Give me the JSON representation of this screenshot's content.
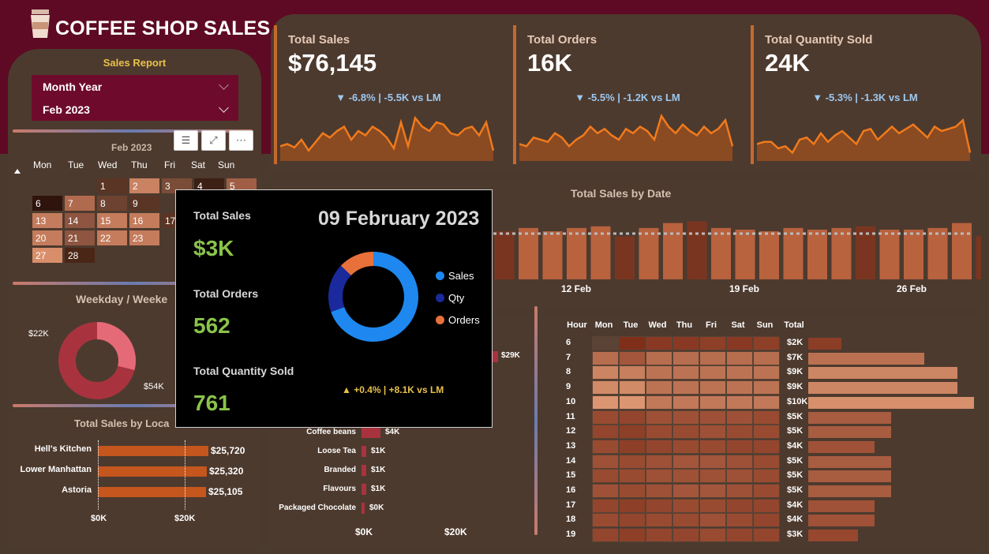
{
  "app": {
    "title": "COFFEE SHOP SALES"
  },
  "colors": {
    "accent": "#c46a2e",
    "brand": "#5e0a24",
    "delta_down": "#9cc8f0",
    "delta_up": "#e8c14a",
    "value_green": "#8bc34a"
  },
  "left": {
    "report_title": "Sales Report",
    "slicer_label": "Month Year",
    "slicer_value": "Feb 2023",
    "calendar": {
      "month_label": "Feb 2023",
      "days_header": [
        "Mon",
        "Tue",
        "Wed",
        "Thu",
        "Fri",
        "Sat",
        "Sun"
      ],
      "weeks": [
        [
          "",
          "",
          "1",
          "2",
          "3",
          "4",
          "5"
        ],
        [
          "6",
          "7",
          "8",
          "9",
          "",
          "",
          ""
        ],
        [
          "13",
          "14",
          "15",
          "16",
          "17",
          "",
          ""
        ],
        [
          "20",
          "21",
          "22",
          "23",
          "",
          "",
          ""
        ],
        [
          "27",
          "28",
          "",
          "",
          "",
          "",
          ""
        ]
      ]
    },
    "weekday_title": "Weekday / Weeke",
    "donut": {
      "label_a": "$22K",
      "label_b": "$54K"
    },
    "location_title": "Total Sales by Loca",
    "locations": [
      {
        "name": "Hell's Kitchen",
        "value": "$25,720",
        "amount": 25720
      },
      {
        "name": "Lower Manhattan",
        "value": "$25,320",
        "amount": 25320
      },
      {
        "name": "Astoria",
        "value": "$25,105",
        "amount": 25105
      }
    ],
    "location_axis": [
      "$0K",
      "$20K"
    ]
  },
  "kpis": [
    {
      "title": "Total Sales",
      "value": "$76,145",
      "delta": "▼ -6.8% | -5.5K vs LM"
    },
    {
      "title": "Total Orders",
      "value": "16K",
      "delta": "▼ -5.5% | -1.2K vs LM"
    },
    {
      "title": "Total Quantity Sold",
      "value": "24K",
      "delta": "▼ -5.3% | -1.3K vs LM"
    }
  ],
  "sparklines": [
    [
      0.25,
      0.3,
      0.22,
      0.4,
      0.15,
      0.35,
      0.55,
      0.45,
      0.6,
      0.7,
      0.4,
      0.6,
      0.5,
      0.7,
      0.6,
      0.45,
      0.2,
      0.8,
      0.25,
      0.9,
      0.7,
      0.6,
      0.8,
      0.75,
      0.55,
      0.5,
      0.65,
      0.7,
      0.5,
      0.8,
      0.15
    ],
    [
      0.3,
      0.25,
      0.45,
      0.4,
      0.35,
      0.55,
      0.45,
      0.25,
      0.4,
      0.5,
      0.7,
      0.55,
      0.65,
      0.5,
      0.4,
      0.65,
      0.55,
      0.7,
      0.6,
      0.4,
      0.95,
      0.7,
      0.55,
      0.75,
      0.6,
      0.5,
      0.7,
      0.55,
      0.65,
      0.85,
      0.25
    ],
    [
      0.3,
      0.35,
      0.35,
      0.2,
      0.25,
      0.1,
      0.4,
      0.45,
      0.3,
      0.55,
      0.35,
      0.5,
      0.6,
      0.45,
      0.3,
      0.6,
      0.65,
      0.4,
      0.55,
      0.7,
      0.55,
      0.65,
      0.75,
      0.6,
      0.45,
      0.7,
      0.6,
      0.65,
      0.7,
      0.85,
      0.1
    ]
  ],
  "sales_by_date": {
    "title": "Total Sales by Date",
    "x_labels": [
      "12 Feb",
      "19 Feb",
      "26 Feb"
    ],
    "bars": [
      0.58,
      0.58,
      0.62,
      0.58,
      0.62,
      0.64,
      0.52,
      0.62,
      0.68,
      0.7,
      0.62,
      0.6,
      0.58,
      0.62,
      0.6,
      0.62,
      0.64,
      0.6,
      0.6,
      0.62,
      0.68,
      0.52
    ]
  },
  "tooltip": {
    "total_sales_label": "Total Sales",
    "total_sales": "$3K",
    "total_orders_label": "Total Orders",
    "total_orders": "562",
    "total_qty_label": "Total Quantity Sold",
    "total_qty": "761",
    "date": "09 February 2023",
    "legend": [
      "Sales",
      "Qty",
      "Orders"
    ],
    "delta": "▲ +0.4% | +8.1K vs LM",
    "donut_values": [
      3000,
      761,
      562
    ]
  },
  "products": {
    "top_label": "$29K",
    "items": [
      {
        "name": "Coffee beans",
        "value": "$4K",
        "amount": 4
      },
      {
        "name": "Loose Tea",
        "value": "$1K",
        "amount": 1
      },
      {
        "name": "Branded",
        "value": "$1K",
        "amount": 1
      },
      {
        "name": "Flavours",
        "value": "$1K",
        "amount": 1
      },
      {
        "name": "Packaged Chocolate",
        "value": "$0K",
        "amount": 0.3
      }
    ],
    "axis": [
      "$0K",
      "$20K"
    ]
  },
  "heatmap": {
    "header": [
      "Hour",
      "Mon",
      "Tue",
      "Wed",
      "Thu",
      "Fri",
      "Sat",
      "Sun",
      "Total"
    ],
    "hours": [
      "6",
      "7",
      "8",
      "9",
      "10",
      "11",
      "12",
      "13",
      "14",
      "15",
      "16",
      "17",
      "18",
      "19"
    ],
    "totals": [
      "$2K",
      "$7K",
      "$9K",
      "$9K",
      "$10K",
      "$5K",
      "$5K",
      "$4K",
      "$5K",
      "$5K",
      "$5K",
      "$4K",
      "$4K",
      "$3K"
    ],
    "total_values": [
      2,
      7,
      9,
      9,
      10,
      5,
      5,
      4,
      5,
      5,
      5,
      4,
      4,
      3
    ],
    "intensity": [
      [
        0.0,
        0.95,
        0.85,
        0.85,
        0.8,
        0.85,
        0.8
      ],
      [
        0.4,
        0.6,
        0.4,
        0.4,
        0.4,
        0.4,
        0.4
      ],
      [
        0.2,
        0.25,
        0.35,
        0.35,
        0.35,
        0.35,
        0.35
      ],
      [
        0.15,
        0.15,
        0.35,
        0.35,
        0.35,
        0.35,
        0.35
      ],
      [
        0.05,
        0.05,
        0.3,
        0.3,
        0.3,
        0.3,
        0.3
      ],
      [
        0.7,
        0.75,
        0.65,
        0.65,
        0.65,
        0.65,
        0.7
      ],
      [
        0.75,
        0.8,
        0.7,
        0.7,
        0.65,
        0.7,
        0.7
      ],
      [
        0.7,
        0.8,
        0.75,
        0.7,
        0.7,
        0.75,
        0.75
      ],
      [
        0.65,
        0.7,
        0.65,
        0.6,
        0.6,
        0.65,
        0.7
      ],
      [
        0.7,
        0.7,
        0.65,
        0.65,
        0.65,
        0.65,
        0.7
      ],
      [
        0.65,
        0.7,
        0.65,
        0.6,
        0.6,
        0.65,
        0.7
      ],
      [
        0.75,
        0.8,
        0.75,
        0.7,
        0.7,
        0.75,
        0.75
      ],
      [
        0.7,
        0.75,
        0.7,
        0.7,
        0.65,
        0.7,
        0.75
      ],
      [
        0.75,
        0.8,
        0.75,
        0.75,
        0.7,
        0.75,
        0.75
      ]
    ]
  }
}
